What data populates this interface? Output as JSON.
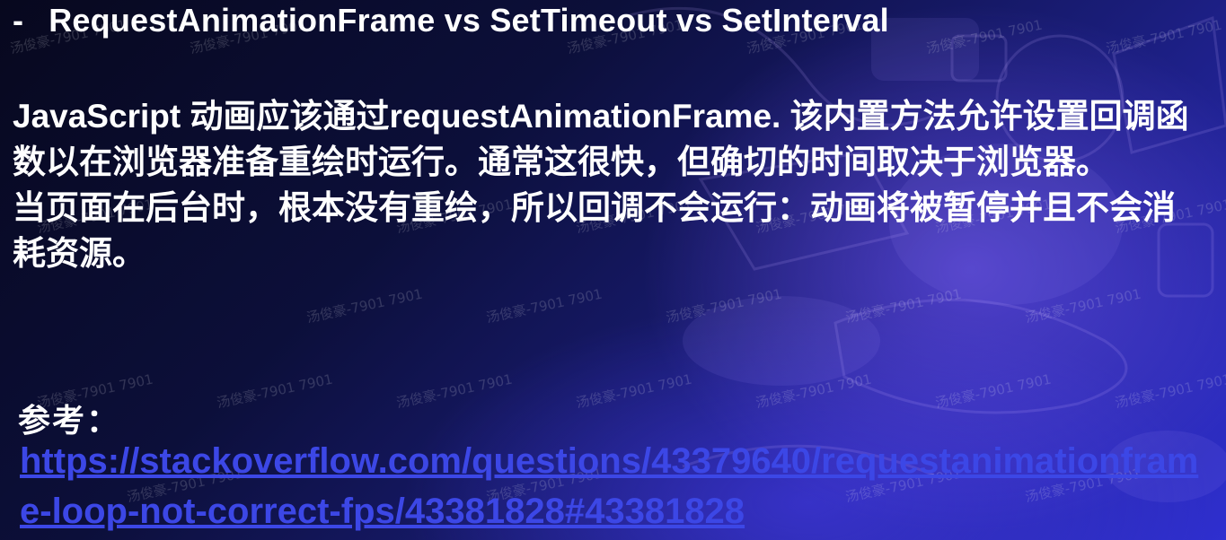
{
  "slide": {
    "heading_bullet": "-",
    "heading": "RequestAnimationFrame vs SetTimeout vs SetInterval",
    "paragraphs": [
      "JavaScript 动画应该通过requestAnimationFrame. 该内置方法允许设置回调函数以在浏览器准备重绘时运行。通常这很快，但确切的时间取决于浏览器。",
      "当页面在后台时，根本没有重绘，所以回调不会运行：动画将被暂停并且不会消耗资源。"
    ],
    "reference_label": "参考：",
    "reference_url": "https://stackoverflow.com/questions/43379640/requestanimationframe-loop-not-correct-fps/43381828#43381828"
  },
  "watermark_text": "汤俊豪-7901 7901",
  "colors": {
    "link": "#3c47e6",
    "text": "#ffffff",
    "background_dark": "#07081e",
    "background_light": "#2f2fd0"
  }
}
